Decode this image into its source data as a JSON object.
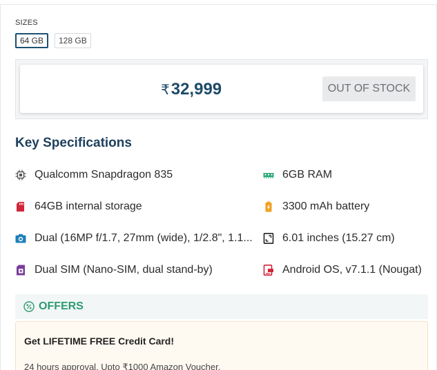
{
  "sizes": {
    "label": "SIZES",
    "options": [
      {
        "label": "64 GB",
        "selected": true
      },
      {
        "label": "128 GB",
        "selected": false
      }
    ]
  },
  "price": {
    "currency": "₹",
    "amount": "32,999",
    "stock_status": "OUT OF STOCK"
  },
  "specs": {
    "title": "Key Specifications",
    "items": [
      {
        "icon": "processor-chip-icon",
        "text": "Qualcomm Snapdragon 835"
      },
      {
        "icon": "ram-icon",
        "text": "6GB RAM"
      },
      {
        "icon": "storage-card-icon",
        "text": "64GB internal storage"
      },
      {
        "icon": "battery-icon",
        "text": "3300 mAh battery"
      },
      {
        "icon": "camera-icon",
        "text": "Dual (16MP f/1.7, 27mm (wide), 1/2.8\", 1.1..."
      },
      {
        "icon": "screen-size-icon",
        "text": "6.01 inches (15.27 cm)"
      },
      {
        "icon": "sim-card-icon",
        "text": "Dual SIM (Nano-SIM, dual stand-by)"
      },
      {
        "icon": "os-icon",
        "text": "Android OS, v7.1.1 (Nougat)"
      }
    ]
  },
  "offers": {
    "label": "OFFERS",
    "card": {
      "title": "Get LIFETIME FREE Credit Card!",
      "description": "24 hours approval, Upto ₹1000 Amazon Voucher,"
    }
  },
  "colors": {
    "accent": "#1d4f72",
    "offers_green": "#2e9a6f",
    "price_text": "#1e4a6a"
  }
}
